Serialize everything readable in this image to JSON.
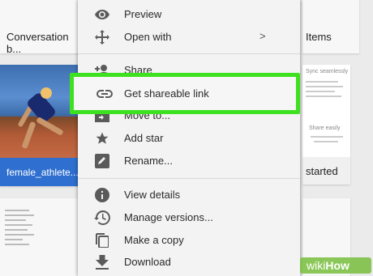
{
  "background_cards": {
    "conversation_title": "Conversation b...",
    "items_title": "Items",
    "athlete_label": "female_athlete...",
    "started_label": "started",
    "right_card_heading": "Sync seamlessly",
    "right_card_sub": "Share easily"
  },
  "menu": {
    "items": [
      {
        "label": "Preview",
        "icon": "eye-icon"
      },
      {
        "label": "Open with",
        "icon": "move-icon",
        "submenu": ">"
      },
      {
        "label": "Share",
        "icon": "add-person-icon"
      },
      {
        "label": "Get shareable link",
        "icon": "link-icon"
      },
      {
        "label": "Move to...",
        "icon": "move-to-folder-icon"
      },
      {
        "label": "Add star",
        "icon": "star-icon"
      },
      {
        "label": "Rename...",
        "icon": "rename-icon"
      },
      {
        "label": "View details",
        "icon": "info-icon"
      },
      {
        "label": "Manage versions...",
        "icon": "history-icon"
      },
      {
        "label": "Make a copy",
        "icon": "copy-icon"
      },
      {
        "label": "Download",
        "icon": "download-icon"
      }
    ]
  },
  "watermark": {
    "wiki": "wiki",
    "how": "How"
  },
  "colors": {
    "highlight": "#3de11f",
    "brand_blue": "#2f6fd0",
    "menu_bg": "#f3f3f3"
  }
}
